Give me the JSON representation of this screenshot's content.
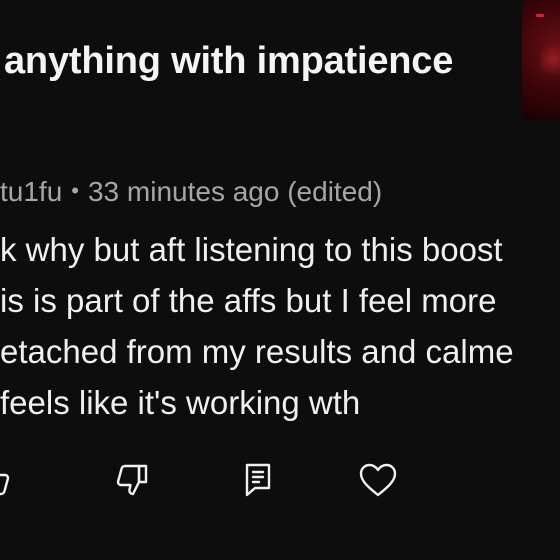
{
  "video": {
    "title": "anything with impatience"
  },
  "comment": {
    "author": "tu1fu",
    "separator": "•",
    "timestamp": "33 minutes ago (edited)",
    "lines": [
      "k why but aft listening to this boost",
      "is is part of the affs but I feel more",
      "etached from my results and calme",
      "feels like it's working wth"
    ]
  },
  "actions": {
    "like_icon": "thumbs-up-icon",
    "dislike_icon": "thumbs-down-icon",
    "reply_icon": "reply-icon",
    "heart_icon": "heart-icon"
  },
  "colors": {
    "background": "#0d0d0d",
    "text_primary": "#f0f0f0",
    "text_secondary": "#a6a6a6"
  }
}
